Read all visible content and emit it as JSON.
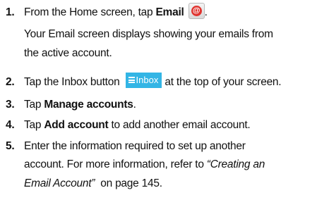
{
  "steps": [
    {
      "number": "1.",
      "pre": "From the Home screen, tap ",
      "bold": "Email",
      "icon": "email-app-icon",
      "post": ".",
      "note_line1": "Your Email screen displays showing your emails from",
      "note_line2": "the active account."
    },
    {
      "number": "2.",
      "pre": "Tap the Inbox button ",
      "button_label": "Inbox",
      "post": " at the top of your screen."
    },
    {
      "number": "3.",
      "pre": "Tap ",
      "bold": "Manage accounts",
      "post": "."
    },
    {
      "number": "4.",
      "pre": "Tap ",
      "bold": "Add account",
      "post": " to add another email account."
    },
    {
      "number": "5.",
      "line1": "Enter the information required to set up another",
      "line2_pre": "account. For more information, refer to ",
      "line2_ital": "“Creating an",
      "line3_ital": "Email Account”",
      "line3_post": "  on page 145."
    }
  ],
  "colors": {
    "text": "#111111",
    "inbox_button_bg": "#33b5e5",
    "email_icon_red": "#e0342f"
  }
}
